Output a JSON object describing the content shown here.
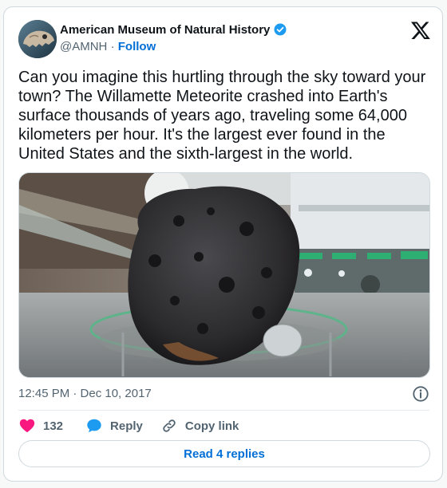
{
  "author": {
    "display_name": "American Museum of Natural History",
    "handle": "@AMNH",
    "separator": "·",
    "follow_label": "Follow",
    "verified": true
  },
  "tweet": {
    "text": "Can you imagine this hurtling through the sky toward your town? The Willamette Meteorite crashed into Earth's surface thousands of years ago, traveling some 64,000 kilometers per hour. It's the largest ever found in the United States and the sixth-largest in the world.",
    "timestamp": "12:45 PM · Dec 10, 2017"
  },
  "actions": {
    "like_count": "132",
    "reply_label": "Reply",
    "copy_link_label": "Copy link"
  },
  "read_replies_label": "Read 4 replies",
  "colors": {
    "accent": "#006fd6",
    "like": "#f91880",
    "verified": "#1d9bf0",
    "muted_text": "#536471"
  },
  "icons": [
    "avatar-dinosaur-skull",
    "verified-badge-icon",
    "x-logo-icon",
    "info-icon",
    "heart-icon",
    "reply-bubble-icon",
    "link-icon"
  ]
}
